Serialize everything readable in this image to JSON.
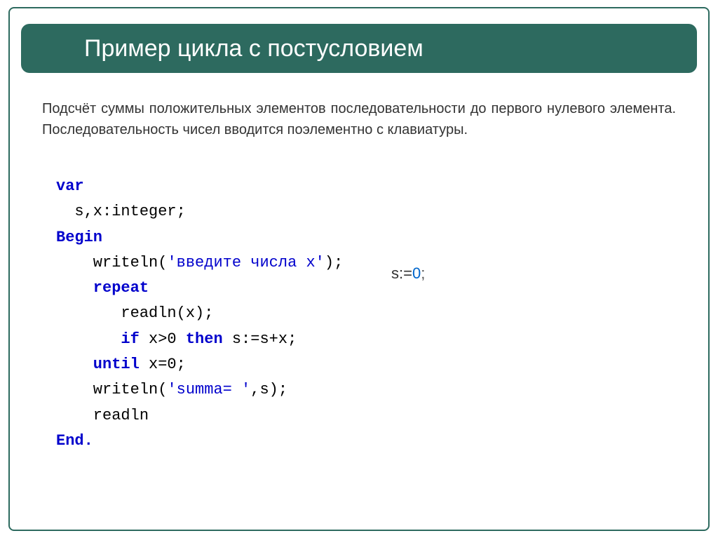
{
  "header": {
    "title": "Пример цикла с постусловием"
  },
  "description": "Подсчёт суммы положительных элементов последовательности до первого нулевого элемента. Последовательность чисел вводится поэлементно с клавиатуры.",
  "code": {
    "kw_var": "var",
    "decl": "  s,x:integer;",
    "kw_begin": "Begin",
    "writeln1_pre": "    writeln(",
    "writeln1_str": "'введите числа x'",
    "writeln1_post": ");",
    "kw_repeat": "    repeat",
    "readln_x": "       readln(x);",
    "if_pre": "       ",
    "kw_if": "if",
    "if_mid": " x>0 ",
    "kw_then": "then",
    "if_post": " s:=s+x;",
    "kw_until": "    until",
    "until_cond": " x=0;",
    "writeln2_pre": "    writeln(",
    "writeln2_str": "'summa= '",
    "writeln2_post": ",s);",
    "readln_final": "    readln",
    "kw_end": "End."
  },
  "annotation": {
    "prefix": "s:=",
    "zero": "0",
    "semi": ";"
  }
}
